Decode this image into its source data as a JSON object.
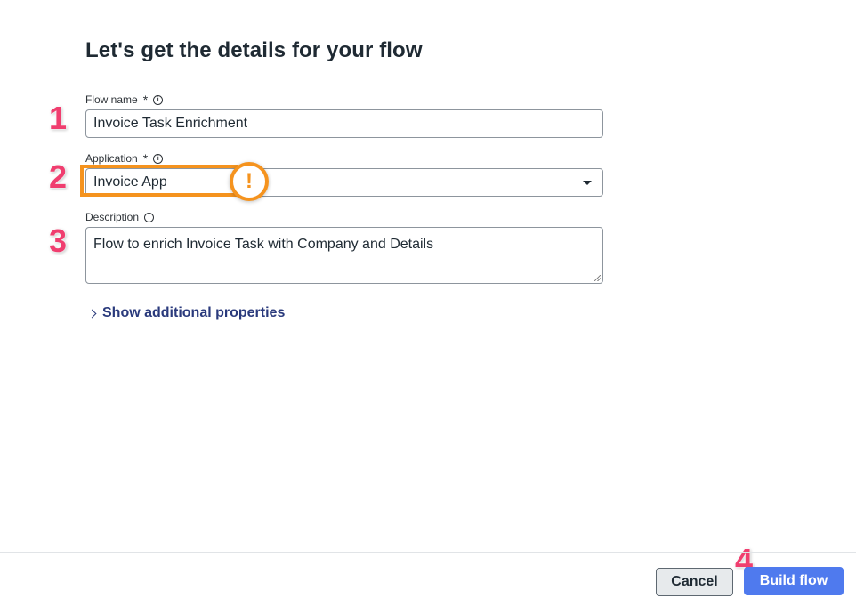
{
  "title": "Let's get the details for your flow",
  "fields": {
    "flow_name": {
      "label": "Flow name",
      "required_marker": "*",
      "value": "Invoice Task Enrichment"
    },
    "application": {
      "label": "Application",
      "required_marker": "*",
      "value": "Invoice App"
    },
    "description": {
      "label": "Description",
      "value": "Flow to enrich Invoice Task with Company and Details"
    }
  },
  "show_additional": "Show additional properties",
  "alert_symbol": "!",
  "info_symbol": "i",
  "steps": [
    "1",
    "2",
    "3",
    "4"
  ],
  "buttons": {
    "cancel": "Cancel",
    "build": "Build flow"
  },
  "colors": {
    "highlight": "#f5931e",
    "step_number": "#f03e6f",
    "primary_button": "#4f7aee",
    "link": "#2a3a7c"
  }
}
